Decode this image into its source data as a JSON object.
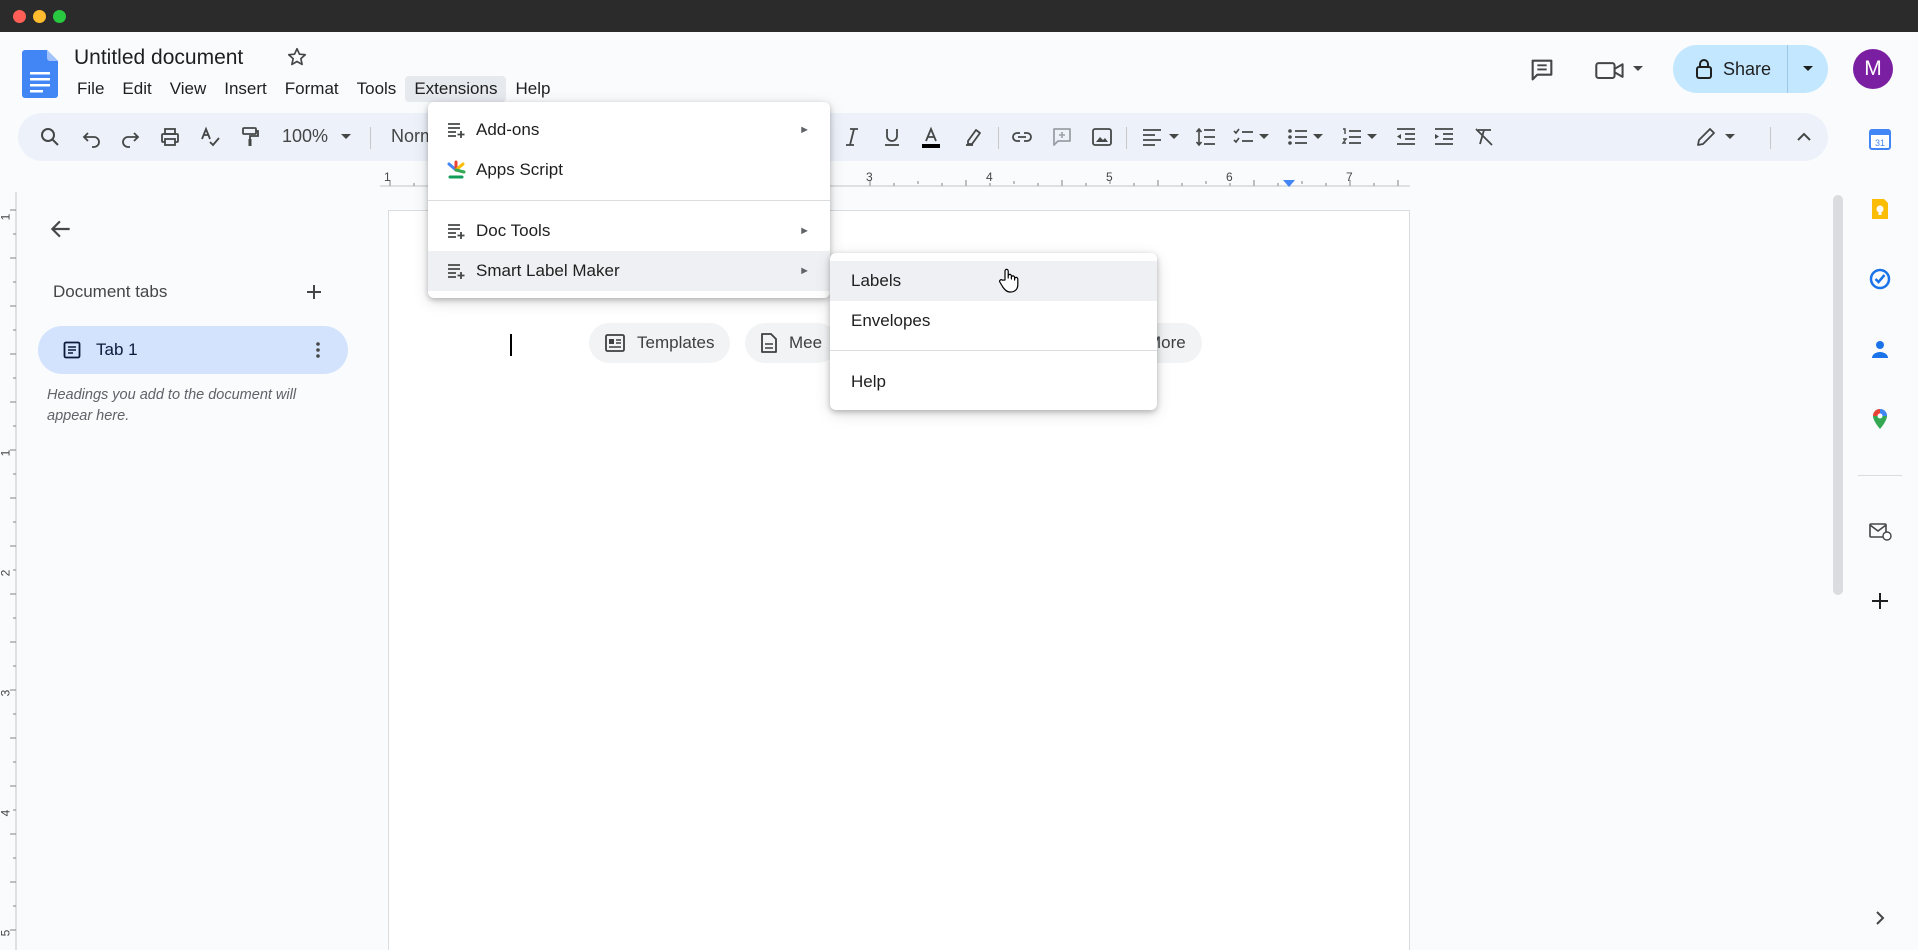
{
  "document": {
    "title": "Untitled document"
  },
  "menubar": [
    "File",
    "Edit",
    "View",
    "Insert",
    "Format",
    "Tools",
    "Extensions",
    "Help"
  ],
  "header": {
    "share_label": "Share",
    "avatar_letter": "M"
  },
  "toolbar": {
    "zoom": "100%",
    "style_partial": "Norm"
  },
  "ruler": {
    "h_numbers": [
      "1",
      "3",
      "4",
      "5",
      "6",
      "7"
    ],
    "v_numbers": [
      "1",
      "1",
      "2",
      "3",
      "4",
      "5"
    ]
  },
  "outline": {
    "tabs_title": "Document tabs",
    "tab_name": "Tab 1",
    "hint": "Headings you add to the document will appear here."
  },
  "chips": {
    "templates": "Templates",
    "meeting_partial": "Mee",
    "more_partial": "More"
  },
  "extensions_menu": {
    "items": [
      {
        "label": "Add-ons",
        "icon": "add-ons-icon",
        "has_submenu": true
      },
      {
        "label": "Apps Script",
        "icon": "apps-script-icon",
        "has_submenu": false
      },
      {
        "label": "Doc Tools",
        "icon": "add-ons-icon",
        "has_submenu": true
      },
      {
        "label": "Smart Label Maker",
        "icon": "add-ons-icon",
        "has_submenu": true
      }
    ],
    "arrow": "►"
  },
  "submenu": {
    "items": [
      "Labels",
      "Envelopes",
      "Help"
    ]
  },
  "colors": {
    "accent_blue": "#0b57d0",
    "share_bg": "#c2e7ff",
    "avatar_bg": "#7b1fa2",
    "tab_active_bg": "#d3e3fd"
  }
}
